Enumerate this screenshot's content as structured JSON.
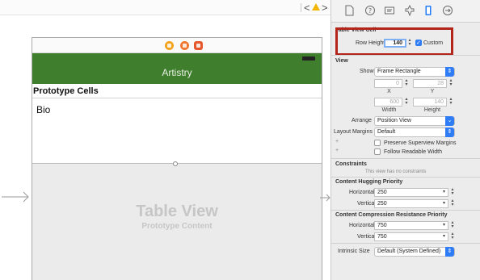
{
  "jumpbar": {
    "back": "<",
    "forward": ">",
    "warning_icon": "warning-icon"
  },
  "canvas": {
    "dock_icons": [
      "view-controller-icon",
      "first-responder-icon",
      "exit-icon"
    ],
    "navbar": {
      "title": "Artistry",
      "color": "#3f7e2c"
    },
    "prototype_header": "Prototype Cells",
    "cell_label": "Bio",
    "table_view": {
      "title": "Table View",
      "subtitle": "Prototype Content"
    }
  },
  "inspector": {
    "tabs": [
      "file-icon",
      "help-icon",
      "identity-icon",
      "attributes-icon",
      "size-icon",
      "connections-icon"
    ],
    "active_tab": "size-icon",
    "table_view_cell": {
      "title": "Table View Cell",
      "row_height_label": "Row Height",
      "row_height_value": "140",
      "custom_label": "Custom",
      "custom_checked": true
    },
    "view": {
      "title": "View",
      "show_label": "Show",
      "show_value": "Frame Rectangle",
      "x_value": "0",
      "y_value": "28",
      "x_label": "X",
      "y_label": "Y",
      "width_value": "600",
      "height_value": "140",
      "width_label": "Width",
      "height_label": "Height",
      "arrange_label": "Arrange",
      "arrange_value": "Position View",
      "layout_margins_label": "Layout Margins",
      "layout_margins_value": "Default",
      "preserve_label": "Preserve Superview Margins",
      "follow_label": "Follow Readable Width"
    },
    "constraints": {
      "title": "Constraints",
      "empty_text": "This view has no constraints"
    },
    "hugging": {
      "title": "Content Hugging Priority",
      "horizontal_label": "Horizontal",
      "horizontal_value": "250",
      "vertical_label": "Vertical",
      "vertical_value": "250"
    },
    "compression": {
      "title": "Content Compression Resistance Priority",
      "horizontal_label": "Horizontal",
      "horizontal_value": "750",
      "vertical_label": "Vertical",
      "vertical_value": "750"
    },
    "intrinsic": {
      "label": "Intrinsic Size",
      "value": "Default (System Defined)"
    }
  },
  "colors": {
    "highlight": "#b3241a",
    "accent": "#2e7cf6"
  }
}
